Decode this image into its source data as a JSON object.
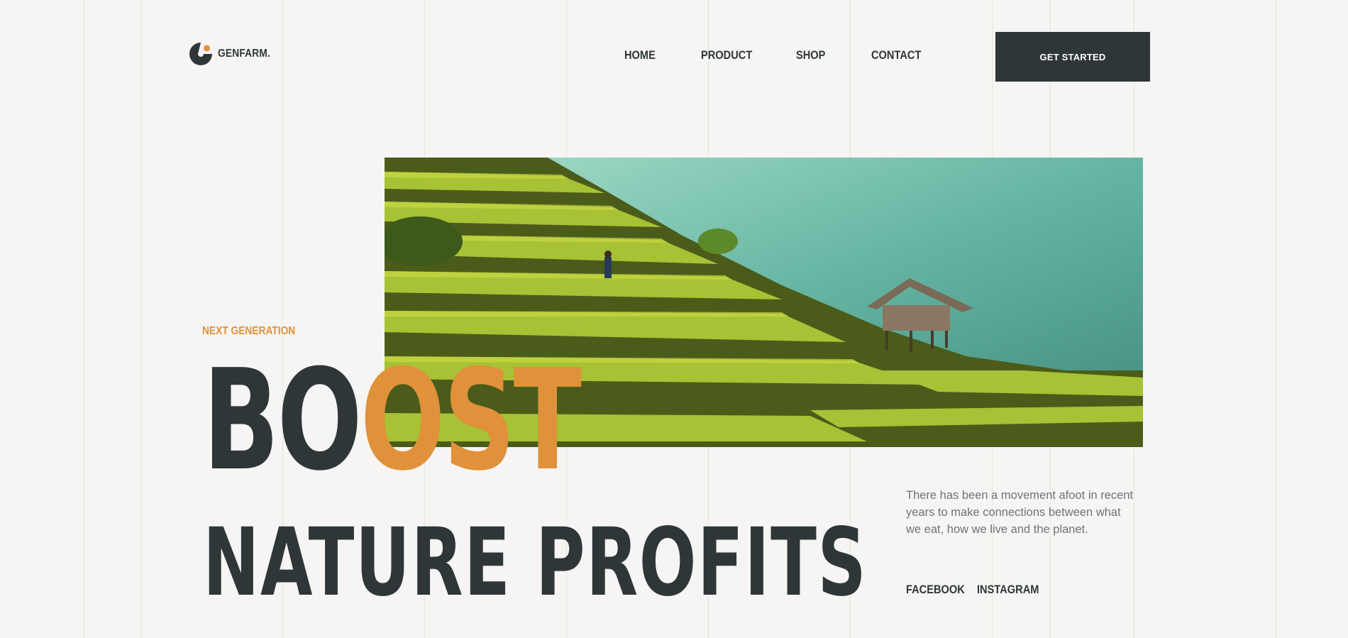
{
  "brand": {
    "name": "GENFARM.",
    "accent_color": "#e0913a",
    "dark_color": "#2e3638"
  },
  "nav": {
    "items": [
      {
        "label": "HOME"
      },
      {
        "label": "PRODUCT"
      },
      {
        "label": "SHOP"
      },
      {
        "label": "CONTACT"
      }
    ]
  },
  "cta": {
    "label": "GET STARTED"
  },
  "hero": {
    "kicker": "NEXT GENERATION",
    "headline_dark": "BO",
    "headline_accent": "OST",
    "headline_line2": "NATURE PROFITS",
    "image_icon": "rice-terraces-photo",
    "description": "There has been a movement afoot in recent years to make connections between what we eat, how we live and the planet."
  },
  "social": {
    "facebook": "FACEBOOK",
    "instagram": "INSTAGRAM"
  }
}
